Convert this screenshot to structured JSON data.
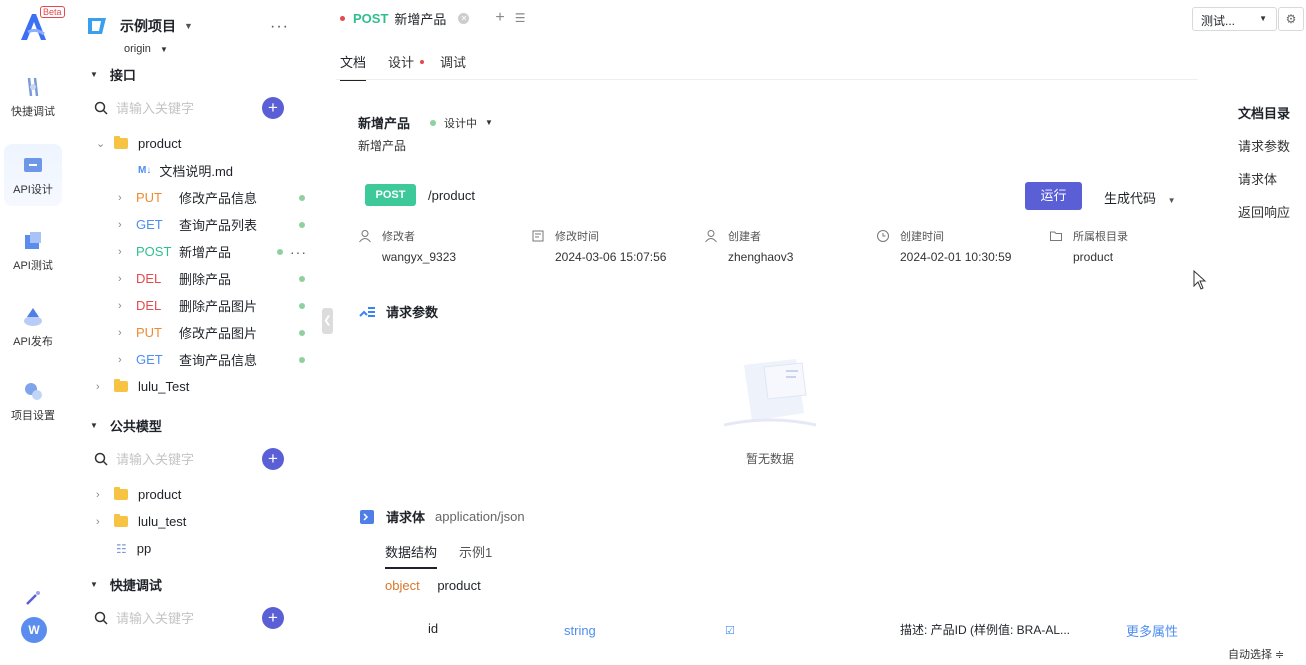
{
  "app": {
    "beta_label": "Beta"
  },
  "rail": {
    "items": [
      {
        "label": "快捷调试",
        "icon": "quick-debug-icon"
      },
      {
        "label": "API设计",
        "icon": "api-design-icon"
      },
      {
        "label": "API测试",
        "icon": "api-test-icon"
      },
      {
        "label": "API发布",
        "icon": "api-publish-icon"
      },
      {
        "label": "项目设置",
        "icon": "project-settings-icon"
      }
    ],
    "avatar": "W"
  },
  "sidebar": {
    "project_name": "示例项目",
    "branch": "origin",
    "interfaces_title": "接口",
    "search_placeholder": "请输入关键字",
    "tree": {
      "folder_product": "product",
      "doc": "文档说明.md",
      "apis": [
        {
          "method": "PUT",
          "name": "修改产品信息"
        },
        {
          "method": "GET",
          "name": "查询产品列表"
        },
        {
          "method": "POST",
          "name": "新增产品"
        },
        {
          "method": "DEL",
          "name": "删除产品"
        },
        {
          "method": "DEL",
          "name": "删除产品图片"
        },
        {
          "method": "PUT",
          "name": "修改产品图片"
        },
        {
          "method": "GET",
          "name": "查询产品信息"
        }
      ],
      "folder_lulu": "lulu_Test"
    },
    "models_title": "公共模型",
    "models": {
      "folder1": "product",
      "folder2": "lulu_test",
      "item": "pp"
    },
    "quick_title": "快捷调试"
  },
  "tabbar": {
    "method": "POST",
    "title": "新增产品"
  },
  "env": {
    "label": "测试..."
  },
  "subtabs": {
    "doc": "文档",
    "design": "设计",
    "debug": "调试"
  },
  "api": {
    "name": "新增产品",
    "status": "设计中",
    "description": "新增产品",
    "method": "POST",
    "path": "/product",
    "run": "运行",
    "gen_code": "生成代码"
  },
  "meta": {
    "modifier_label": "修改者",
    "modifier": "wangyx_9323",
    "mtime_label": "修改时间",
    "mtime": "2024-03-06 15:07:56",
    "creator_label": "创建者",
    "creator": "zhenghaov3",
    "ctime_label": "创建时间",
    "ctime": "2024-02-01 10:30:59",
    "root_label": "所属根目录",
    "root": "product"
  },
  "params": {
    "title": "请求参数",
    "empty": "暂无数据"
  },
  "body": {
    "title": "请求体",
    "content_type": "application/json",
    "tab_schema": "数据结构",
    "tab_example": "示例1",
    "object_type": "object",
    "object_name": "product",
    "field": {
      "name": "id",
      "type": "string",
      "desc": "描述:  产品ID (样例值: BRA-AL...",
      "more": "更多属性"
    }
  },
  "toc": {
    "title": "文档目录",
    "items": [
      "请求参数",
      "请求体",
      "返回响应"
    ]
  },
  "footer": {
    "auto_select": "自动选择 ≑"
  },
  "colors": {
    "accent": "#5a5fd6",
    "post": "#2fbf8f",
    "put": "#ee8b32",
    "get": "#4e8ef0",
    "del": "#e5484d"
  }
}
